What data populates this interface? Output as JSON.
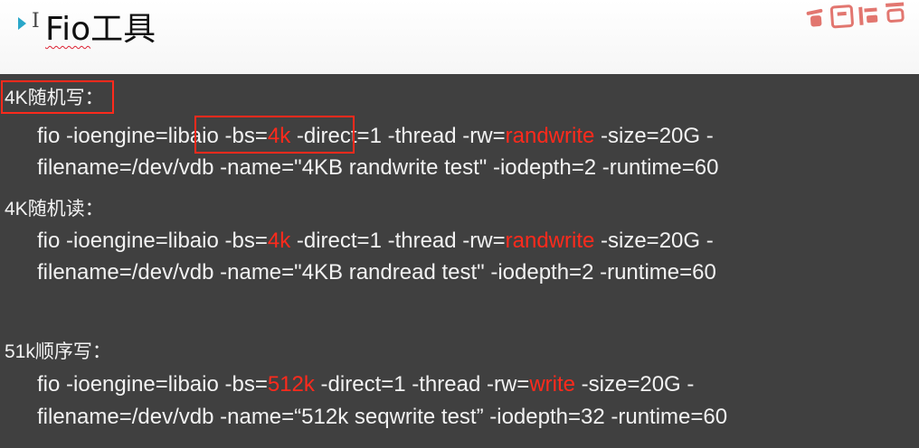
{
  "header": {
    "title_prefix": "Fio",
    "title_suffix": "工具"
  },
  "sections": [
    {
      "heading": "4K随机写：",
      "line1": [
        "fio -ioengine=",
        "libaio -bs=",
        "4k",
        " -direct=1 -thread -rw=",
        "randwrite",
        " -size=20G -"
      ],
      "line2": "filename=/dev/vdb -name=\"4KB randwrite test\" -iodepth=2 -runtime=60"
    },
    {
      "heading": "4K随机读：",
      "line1": [
        "fio -ioengine=libaio -bs=",
        "4k",
        " -direct=1 -thread -rw=",
        "randwrite",
        " -size=20G -"
      ],
      "line2": "filename=/dev/vdb -name=\"4KB randread test\" -iodepth=2 -runtime=60"
    },
    {
      "heading": "51k顺序写：",
      "line1": [
        "fio -ioengine=libaio -bs=",
        "512k",
        " -direct=1 -thread -rw=",
        "write",
        " -size=20G -"
      ],
      "line2": "filename=/dev/vdb -name=“512k seqwrite test” -iodepth=32 -runtime=60"
    }
  ],
  "colors": {
    "panel_bg": "#404040",
    "text": "#f2f2f2",
    "highlight_red": "#ff2a1c",
    "arrow": "#2aa7c9"
  },
  "icons": [
    "triangle-arrow-icon",
    "text-cursor-icon"
  ]
}
